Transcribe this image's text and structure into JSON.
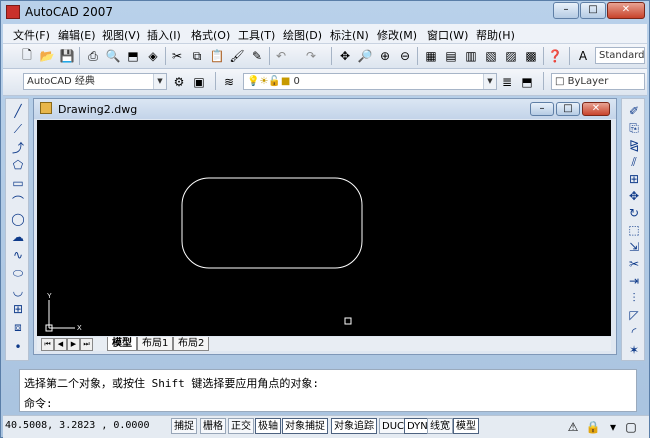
{
  "app": {
    "title": "AutoCAD 2007"
  },
  "window_controls": {
    "minimize": "–",
    "maximize": "□",
    "close": "✕"
  },
  "menu": [
    "文件(F)",
    "编辑(E)",
    "视图(V)",
    "插入(I)",
    "格式(O)",
    "工具(T)",
    "绘图(D)",
    "标注(N)",
    "修改(M)",
    "窗口(W)",
    "帮助(H)"
  ],
  "toolbar": {
    "text_style": "Standard",
    "workspace": "AutoCAD 经典",
    "layer": "0",
    "color": "ByLayer"
  },
  "document": {
    "title": "Drawing2.dwg"
  },
  "ucs": {
    "x_label": "X",
    "y_label": "Y"
  },
  "layout_tabs": [
    "模型",
    "布局1",
    "布局2"
  ],
  "command": {
    "history": "选择第二个对象，或按住 Shift 键选择要应用角点的对象:",
    "prompt": "命令:"
  },
  "status": {
    "coordinates": "40.5008, 3.2823 , 0.0000",
    "buttons": [
      "捕捉",
      "栅格",
      "正交",
      "极轴",
      "对象捕捉",
      "对象追踪",
      "DUCS",
      "DYN",
      "线宽",
      "模型"
    ]
  },
  "icons": {
    "left": [
      "line-icon",
      "construction-line-icon",
      "polyline-icon",
      "polygon-icon",
      "rectangle-icon",
      "arc-icon",
      "circle-icon",
      "revision-cloud-icon",
      "spline-icon",
      "ellipse-icon",
      "ellipse-arc-icon",
      "insert-block-icon",
      "make-block-icon",
      "point-icon"
    ],
    "right": [
      "erase-icon",
      "copy-icon",
      "mirror-icon",
      "offset-icon",
      "array-icon",
      "move-icon",
      "rotate-icon",
      "scale-icon",
      "stretch-icon",
      "trim-icon",
      "extend-icon",
      "break-icon",
      "chamfer-icon",
      "fillet-icon",
      "explode-icon"
    ]
  }
}
